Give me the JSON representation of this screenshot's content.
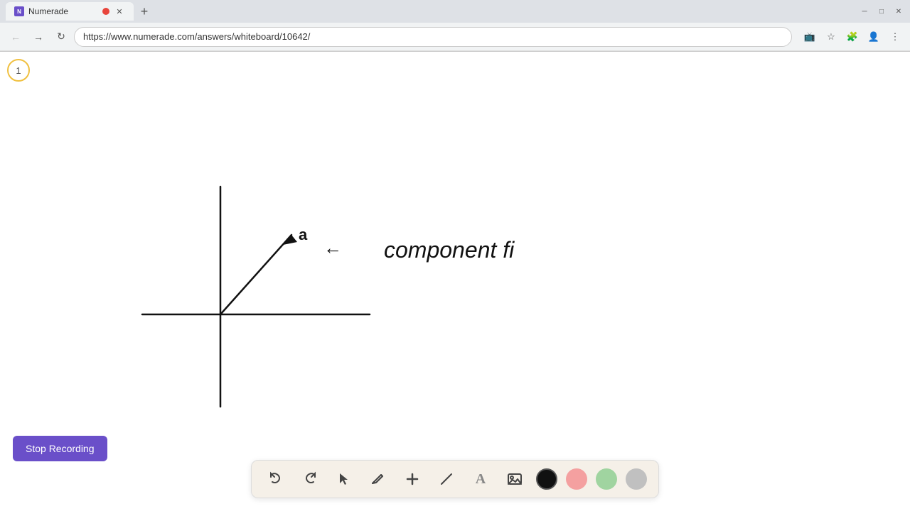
{
  "browser": {
    "tab": {
      "favicon_label": "N",
      "title": "Numerade",
      "url": "https://www.numerade.com/answers/whiteboard/10642/"
    },
    "window_controls": {
      "minimize": "─",
      "maximize": "□",
      "close": "✕"
    },
    "nav": {
      "back_title": "Back",
      "forward_title": "Forward",
      "refresh_title": "Refresh"
    }
  },
  "page": {
    "page_number": "1",
    "drawing_label": "component fi",
    "stop_recording_label": "Stop Recording"
  },
  "toolbar": {
    "undo_label": "↩",
    "redo_label": "↪",
    "select_label": "▶",
    "pencil_label": "✏",
    "add_label": "+",
    "eraser_label": "✂",
    "text_label": "A",
    "image_label": "🖼",
    "colors": [
      "#111111",
      "#f4a0a0",
      "#a0d4a0",
      "#c0c0c0"
    ]
  }
}
